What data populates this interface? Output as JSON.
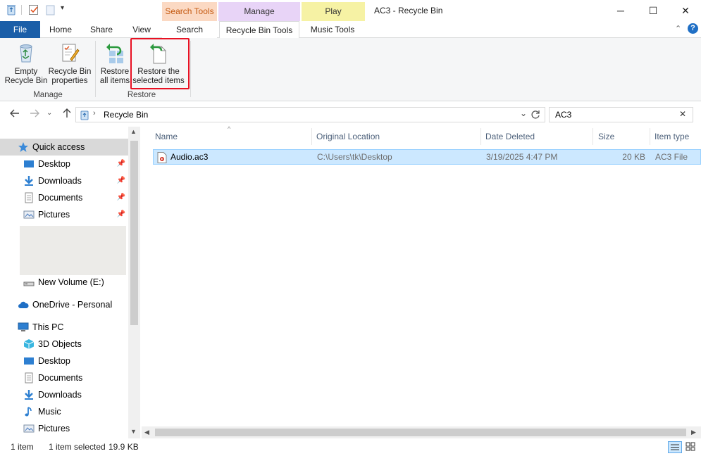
{
  "window": {
    "title": "AC3 - Recycle Bin",
    "controls": {
      "minimize": "─",
      "maximize": "☐",
      "close": "✕"
    }
  },
  "context_tabs": [
    {
      "group": "Search Tools",
      "tab": "Search",
      "color": "#fbd9c3",
      "text_color": "#c55a11"
    },
    {
      "group": "Manage",
      "tab": "Recycle Bin Tools",
      "color": "#e8d4f7",
      "text_color": "#333333"
    },
    {
      "group": "Play",
      "tab": "Music Tools",
      "color": "#f6f2a4",
      "text_color": "#333333"
    }
  ],
  "tabs": {
    "file": "File",
    "home": "Home",
    "share": "Share",
    "view": "View"
  },
  "ribbon": {
    "manage": {
      "label": "Manage",
      "empty": [
        "Empty",
        "Recycle Bin"
      ],
      "properties": [
        "Recycle Bin",
        "properties"
      ]
    },
    "restore": {
      "label": "Restore",
      "all": [
        "Restore",
        "all items"
      ],
      "selected": [
        "Restore the",
        "selected items"
      ]
    }
  },
  "address": {
    "path": "Recycle Bin",
    "search_value": "AC3"
  },
  "nav": {
    "quick_access": "Quick access",
    "desktop": "Desktop",
    "downloads": "Downloads",
    "documents": "Documents",
    "pictures": "Pictures",
    "new_volume": "New Volume (E:)",
    "onedrive": "OneDrive - Personal",
    "this_pc": "This PC",
    "pc_3d": "3D Objects",
    "pc_desktop": "Desktop",
    "pc_documents": "Documents",
    "pc_downloads": "Downloads",
    "pc_music": "Music",
    "pc_pictures": "Pictures"
  },
  "columns": {
    "name": "Name",
    "original_location": "Original Location",
    "date_deleted": "Date Deleted",
    "size": "Size",
    "item_type": "Item type"
  },
  "rows": [
    {
      "name": "Audio.ac3",
      "original_location": "C:\\Users\\tk\\Desktop",
      "date_deleted": "3/19/2025 4:47 PM",
      "size": "20 KB",
      "item_type": "AC3 File"
    }
  ],
  "status": {
    "count": "1 item",
    "selected": "1 item selected",
    "size": "19.9 KB"
  },
  "highlight_color": "#e81123"
}
